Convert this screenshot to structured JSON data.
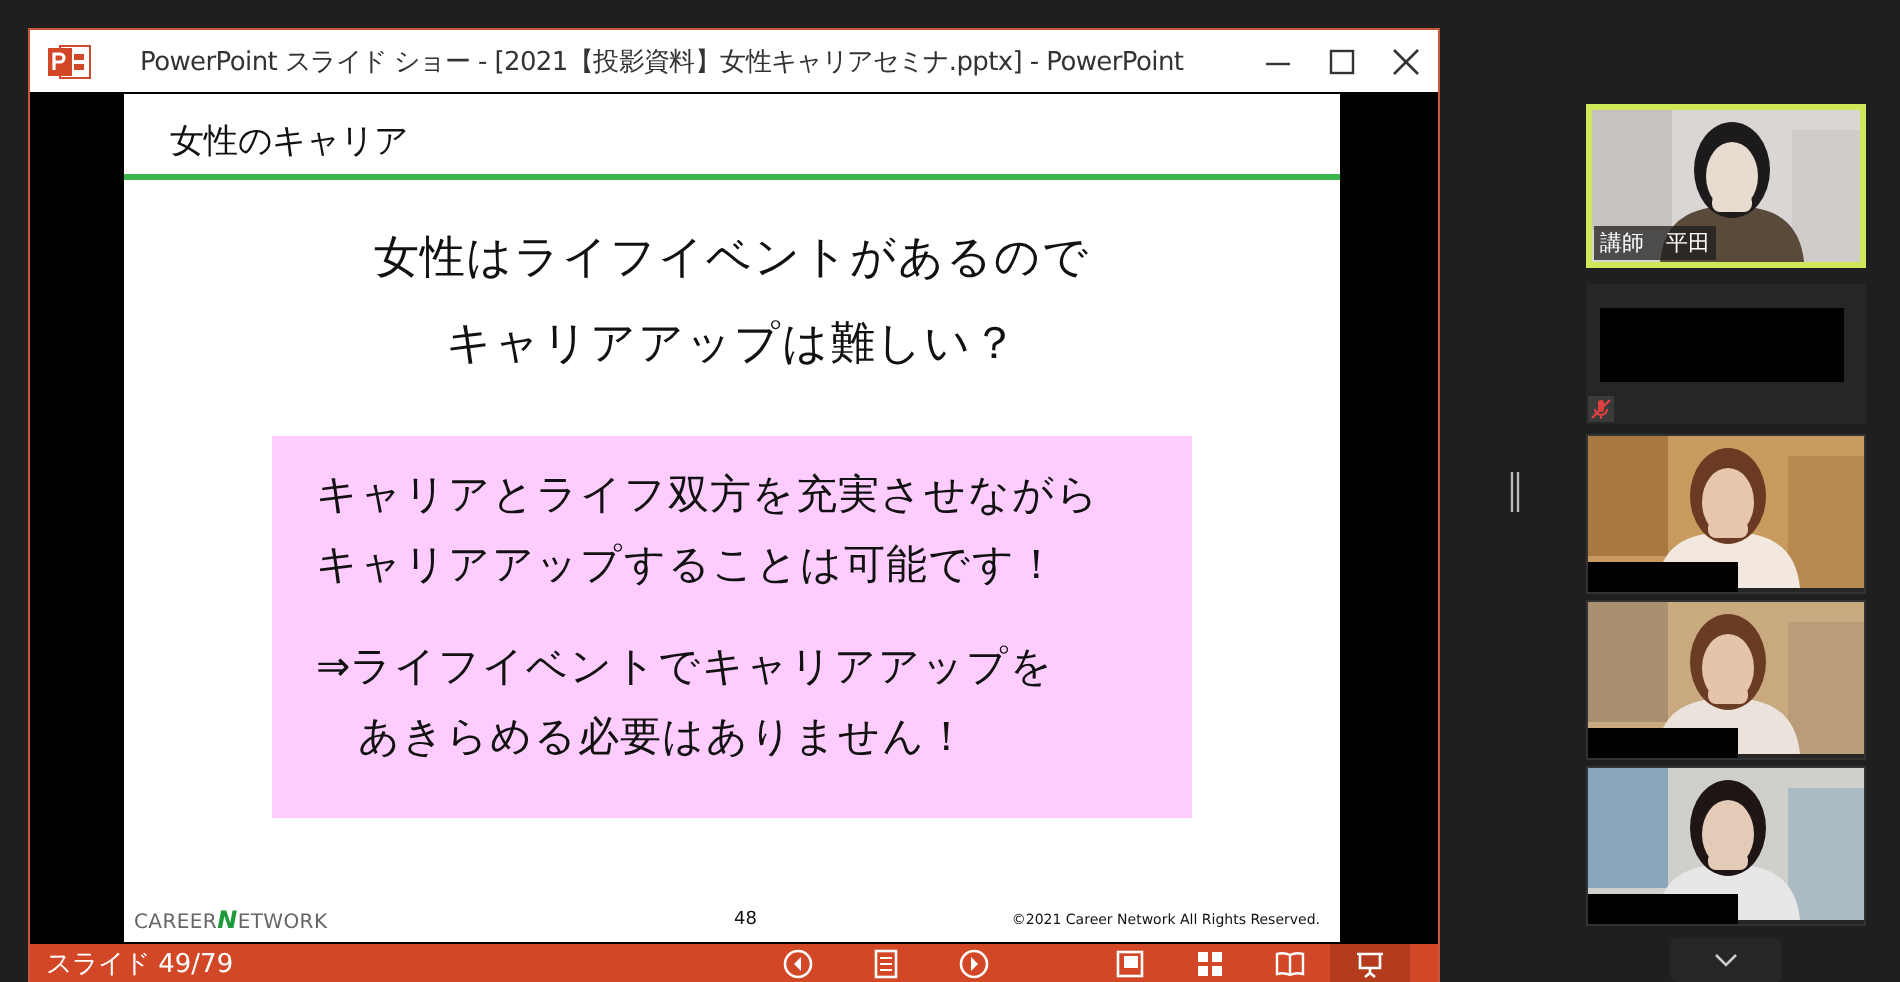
{
  "window": {
    "title": "PowerPoint スライド ショー - [2021【投影資料】女性キャリアセミナ.pptx] - PowerPoint"
  },
  "slide": {
    "heading": "女性のキャリア",
    "question": [
      "女性はライフイベントがあるので",
      "キャリアアップは難しい？"
    ],
    "box_paragraphs": [
      [
        "キャリアとライフ双方を充実させながら",
        "キャリアアップすることは可能です！"
      ],
      [
        "⇒ライフイベントでキャリアアップを",
        "　あきらめる必要はありません！"
      ]
    ],
    "logo": "CAREER**N**ETWORK",
    "page_number": "48",
    "copyright": "©2021 Career  Network All Rights Reserved."
  },
  "status_bar": {
    "slide_counter": "スライド 49/79",
    "nav_buttons": [
      {
        "kind": "previous"
      },
      {
        "kind": "notes"
      },
      {
        "kind": "next"
      }
    ],
    "view_buttons": [
      {
        "kind": "normal",
        "selected": false
      },
      {
        "kind": "sorter",
        "selected": false
      },
      {
        "kind": "reading",
        "selected": false
      },
      {
        "kind": "slideshow",
        "selected": true
      }
    ]
  },
  "participants": [
    {
      "kind": "video",
      "name": "講師　平田",
      "active": true,
      "muted": false
    },
    {
      "kind": "video-off",
      "active": false,
      "muted": true
    },
    {
      "kind": "video",
      "name_hidden": true,
      "active": false,
      "muted": false
    },
    {
      "kind": "video",
      "name_hidden": true,
      "active": false,
      "muted": false
    },
    {
      "kind": "video",
      "name_hidden": true,
      "active": false,
      "muted": false
    }
  ]
}
